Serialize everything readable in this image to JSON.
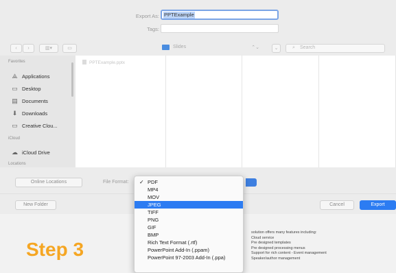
{
  "form": {
    "export_as_label": "Export As:",
    "export_as_value": "PPTExample",
    "tags_label": "Tags:",
    "tags_value": ""
  },
  "toolbar": {
    "back_glyph": "‹",
    "forward_glyph": "›",
    "view_glyph": "▥▾",
    "new_folder_glyph": "▭",
    "location": "Slides",
    "location_arrows": "⌃⌄",
    "expand_glyph": "⌄",
    "search_placeholder": "Search"
  },
  "sidebar": {
    "sections": [
      "Favorites",
      "iCloud",
      "Locations"
    ],
    "favorites": [
      {
        "label": "Applications",
        "icon": "applications-icon"
      },
      {
        "label": "Desktop",
        "icon": "desktop-icon"
      },
      {
        "label": "Documents",
        "icon": "documents-icon"
      },
      {
        "label": "Downloads",
        "icon": "downloads-icon"
      },
      {
        "label": "Creative Clou...",
        "icon": "folder-icon"
      }
    ],
    "icloud": [
      {
        "label": "iCloud Drive",
        "icon": "cloud-icon"
      }
    ]
  },
  "browser": {
    "file_name": "PPTExample.pptx"
  },
  "options": {
    "online_locations": "Online Locations",
    "file_format_label": "File Format:"
  },
  "format_menu": {
    "selected_check": "✓",
    "items": [
      "PDF",
      "MP4",
      "MOV",
      "JPEG",
      "TIFF",
      "PNG",
      "GIF",
      "BMP",
      "Rich Text Format (.rtf)",
      "PowerPoint Add-In (.ppam)",
      "PowerPoint 97-2003 Add-In (.ppa)"
    ],
    "checked_index": 0,
    "highlighted_index": 3
  },
  "buttons": {
    "new_folder": "New Folder",
    "cancel": "Cancel",
    "export": "Export"
  },
  "slide": {
    "title": "Step 3",
    "lines": [
      "solution offers many features including:",
      "Cloud service",
      "Pre designed templates",
      "Pre designed processing menus",
      "Support for rich content - Event management",
      "Speaker/author management"
    ]
  },
  "colors": {
    "accent": "#2c7cf2",
    "step_title": "#f5a623"
  }
}
